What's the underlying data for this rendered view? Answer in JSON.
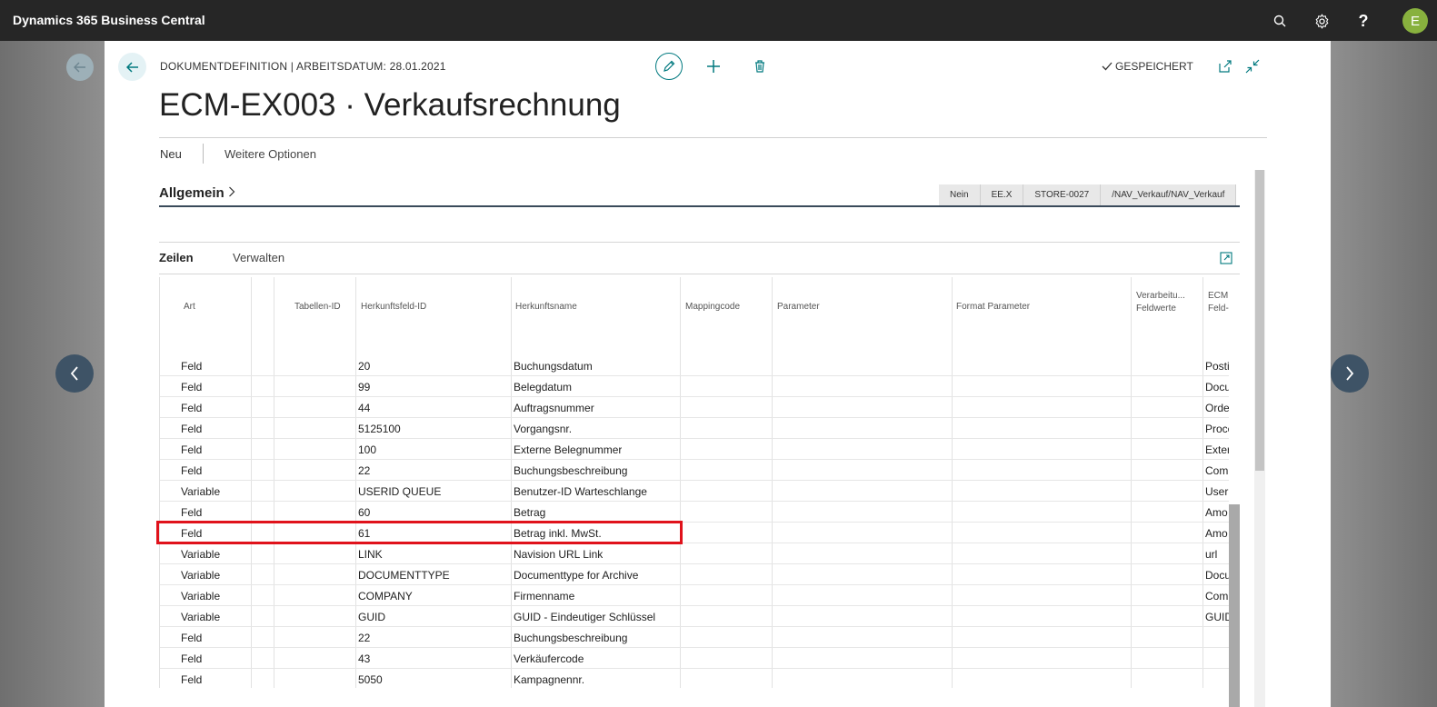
{
  "app": {
    "title": "Dynamics 365 Business Central",
    "user_initial": "E"
  },
  "header_icons": [
    "search-icon",
    "gear-icon",
    "help-icon"
  ],
  "page": {
    "breadcrumb": "DOKUMENTDEFINITION | ARBEITSDATUM: 28.01.2021",
    "title": "ECM-EX003 · Verkaufsrechnung",
    "saved_label": "GESPEICHERT"
  },
  "actions": {
    "new": "Neu",
    "more": "Weitere Optionen"
  },
  "general": {
    "heading": "Allgemein",
    "summary": [
      "Nein",
      "EE.X",
      "STORE-0027",
      "/NAV_Verkauf/NAV_Verkauf"
    ]
  },
  "lines": {
    "tab_lines": "Zeilen",
    "tab_manage": "Verwalten",
    "columns": {
      "art": "Art",
      "table_id": "Tabellen-ID",
      "source_field_id": "Herkunftsfeld-ID",
      "source_name": "Herkunftsname",
      "mapping_code": "Mappingcode",
      "parameter": "Parameter",
      "format_parameter": "Format Parameter",
      "processing_1": "Verarbeitu...",
      "processing_2": "Feldwerte",
      "ecm_1": "ECM Re",
      "ecm_2": "Feld-ID"
    },
    "rows": [
      {
        "art": "Feld",
        "field": "20",
        "name": "Buchungsdatum",
        "ecm": "Posti"
      },
      {
        "art": "Feld",
        "field": "99",
        "name": "Belegdatum",
        "ecm": "Docu"
      },
      {
        "art": "Feld",
        "field": "44",
        "name": "Auftragsnummer",
        "ecm": "Orde"
      },
      {
        "art": "Feld",
        "field": "5125100",
        "name": "Vorgangsnr.",
        "ecm": "Proce"
      },
      {
        "art": "Feld",
        "field": "100",
        "name": "Externe Belegnummer",
        "ecm": "Exter"
      },
      {
        "art": "Feld",
        "field": "22",
        "name": "Buchungsbeschreibung",
        "ecm": "Com"
      },
      {
        "art": "Variable",
        "field": "USERID QUEUE",
        "name": "Benutzer-ID Warteschlange",
        "ecm": "UserI"
      },
      {
        "art": "Feld",
        "field": "60",
        "name": "Betrag",
        "ecm": "Amo"
      },
      {
        "art": "Feld",
        "field": "61",
        "name": "Betrag inkl. MwSt.",
        "ecm": "Amo"
      },
      {
        "art": "Variable",
        "field": "LINK",
        "name": "Navision URL Link",
        "ecm": "url"
      },
      {
        "art": "Variable",
        "field": "DOCUMENTTYPE",
        "name": "Documenttype for Archive",
        "ecm": "Docu"
      },
      {
        "art": "Variable",
        "field": "COMPANY",
        "name": "Firmenname",
        "ecm": "Com"
      },
      {
        "art": "Variable",
        "field": "GUID",
        "name": "GUID - Eindeutiger Schlüssel",
        "ecm": "GUID"
      },
      {
        "art": "Feld",
        "field": "22",
        "name": "Buchungsbeschreibung",
        "ecm": ""
      },
      {
        "art": "Feld",
        "field": "43",
        "name": "Verkäufercode",
        "ecm": ""
      },
      {
        "art": "Feld",
        "field": "5050",
        "name": "Kampagnennr.",
        "ecm": ""
      },
      {
        "art": "Variable",
        "field": "",
        "name": "",
        "ecm": ""
      }
    ],
    "highlighted_row": 10
  },
  "colors": {
    "topbar": "#262626",
    "accent": "#00797f",
    "highlight": "#e0121b",
    "nav_circle": "#3e5366",
    "avatar": "#88b13e"
  }
}
